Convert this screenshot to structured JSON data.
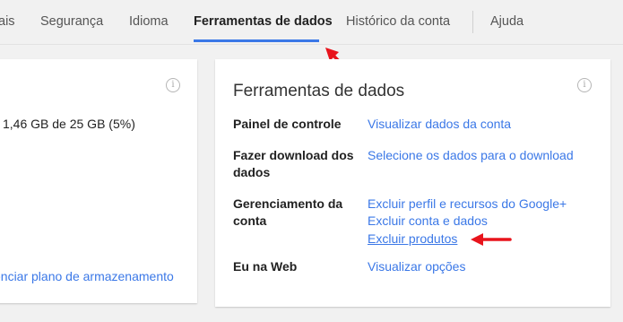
{
  "nav": {
    "tabs": [
      {
        "label": "ais"
      },
      {
        "label": "Segurança"
      },
      {
        "label": "Idioma"
      },
      {
        "label": "Ferramentas de dados"
      },
      {
        "label": "Histórico da conta"
      },
      {
        "label": "Ajuda"
      }
    ],
    "active_tab_index": 3,
    "accent_color": "#3b78e7"
  },
  "storage_card": {
    "usage_text": "1,46 GB de 25 GB (5%)",
    "manage_link": "enciar plano de armazenamento",
    "info_icon": "info-icon"
  },
  "data_tools_card": {
    "title": "Ferramentas de dados",
    "info_icon": "info-icon",
    "rows": [
      {
        "label": "Painel de controle",
        "links": [
          "Visualizar dados da conta"
        ]
      },
      {
        "label": "Fazer download dos dados",
        "links": [
          "Selecione os dados para o download"
        ]
      },
      {
        "label": "Gerenciamento da conta",
        "links": [
          "Excluir perfil e recursos do Google+",
          "Excluir conta e dados",
          "Excluir produtos"
        ]
      },
      {
        "label": "Eu na Web",
        "links": [
          "Visualizar opções"
        ]
      }
    ]
  },
  "annotations": {
    "arrow_color": "#e8141c"
  }
}
